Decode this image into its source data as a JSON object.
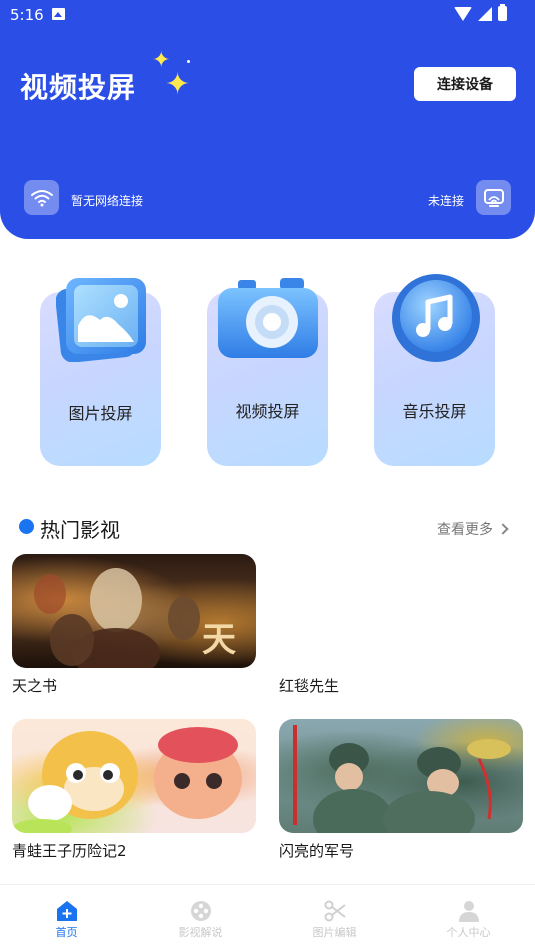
{
  "status_bar": {
    "time": "5:16"
  },
  "header": {
    "title": "视频投屏",
    "connect_button": "连接设备",
    "network_status": "暂无网络连接",
    "connection_status": "未连接"
  },
  "features": [
    {
      "label": "图片投屏",
      "icon": "image-icon"
    },
    {
      "label": "视频投屏",
      "icon": "camera-icon"
    },
    {
      "label": "音乐投屏",
      "icon": "music-note-icon"
    }
  ],
  "hot_section": {
    "title": "热门影视",
    "more_label": "查看更多"
  },
  "movies": [
    {
      "title": "天之书",
      "poster_text": "天"
    },
    {
      "title": "红毯先生"
    },
    {
      "title": "青蛙王子历险记2"
    },
    {
      "title": "闪亮的军号"
    }
  ],
  "bottom_nav": [
    {
      "label": "首页",
      "icon": "home-plus-icon",
      "active": true
    },
    {
      "label": "影视解说",
      "icon": "film-reel-icon",
      "active": false
    },
    {
      "label": "图片编辑",
      "icon": "scissors-icon",
      "active": false
    },
    {
      "label": "个人中心",
      "icon": "person-icon",
      "active": false
    }
  ],
  "colors": {
    "header_bg": "#2a4ee6",
    "accent": "#1a73f0",
    "sparkle": "#ffe94d"
  }
}
